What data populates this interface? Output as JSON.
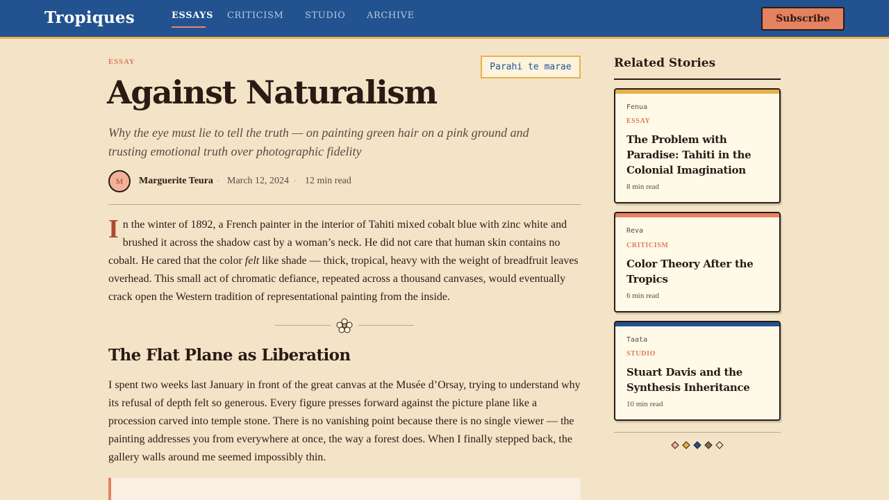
{
  "header": {
    "brand": "Tropiques",
    "nav": [
      {
        "label": "ESSAYS",
        "active": true
      },
      {
        "label": "CRITICISM",
        "active": false
      },
      {
        "label": "STUDIO",
        "active": false
      },
      {
        "label": "ARCHIVE",
        "active": false
      }
    ],
    "subscribe_label": "Subscribe"
  },
  "article": {
    "kicker": "ESSAY",
    "tag": "Parahi te marae",
    "title": "Against Naturalism",
    "dek": "Why the eye must lie to tell the truth — on painting green hair on a pink ground and trusting emotional truth over photographic fidelity",
    "author_initial": "M",
    "author": "Marguerite Teura",
    "date": "March 12, 2024",
    "read_time": "12 min read",
    "separator": "·",
    "dropcap": "I",
    "p1_a": "n the winter of 1892, a French painter in the interior of Tahiti mixed cobalt blue with zinc white and brushed it across the shadow cast by a woman’s neck. He did not care that human skin contains no cobalt. He cared that the color ",
    "p1_em": "felt",
    "p1_b": " like shade — thick, tropical, heavy with the weight of breadfruit leaves overhead. This small act of chromatic defiance, repeated across a thousand canvases, would eventually crack open the Western tradition of representational painting from the inside.",
    "section_heading": "The Flat Plane as Liberation",
    "p2": "I spent two weeks last January in front of the great canvas at the Musée d’Orsay, trying to understand why its refusal of depth felt so generous. Every figure presses forward against the picture plane like a procession carved into temple stone. There is no vanishing point because there is no single viewer — the painting addresses you from everywhere at once, the way a forest does. When I finally stepped back, the gallery walls around me seemed impossibly thin."
  },
  "sidebar": {
    "title": "Related Stories",
    "cards": [
      {
        "source": "Fenua",
        "category": "ESSAY",
        "title": "The Problem with Paradise: Tahiti in the Colonial Imagination",
        "read_time": "8 min read",
        "accent": "#e8b04a"
      },
      {
        "source": "Reva",
        "category": "CRITICISM",
        "title": "Color Theory After the Tropics",
        "read_time": "6 min read",
        "accent": "#e5825f"
      },
      {
        "source": "Taata",
        "category": "STUDIO",
        "title": "Stuart Davis and the Synthesis Inheritance",
        "read_time": "10 min read",
        "accent": "#22528f"
      }
    ],
    "dot_colors": [
      "#f2b29a",
      "#e8b04a",
      "#22528f",
      "#8a6a4a",
      "#f3e4c8"
    ]
  },
  "colors": {
    "nav_bg": "#22528f",
    "accent_gold": "#e8b04a",
    "accent_coral": "#e5825f",
    "page_bg": "#f3e4c8"
  }
}
